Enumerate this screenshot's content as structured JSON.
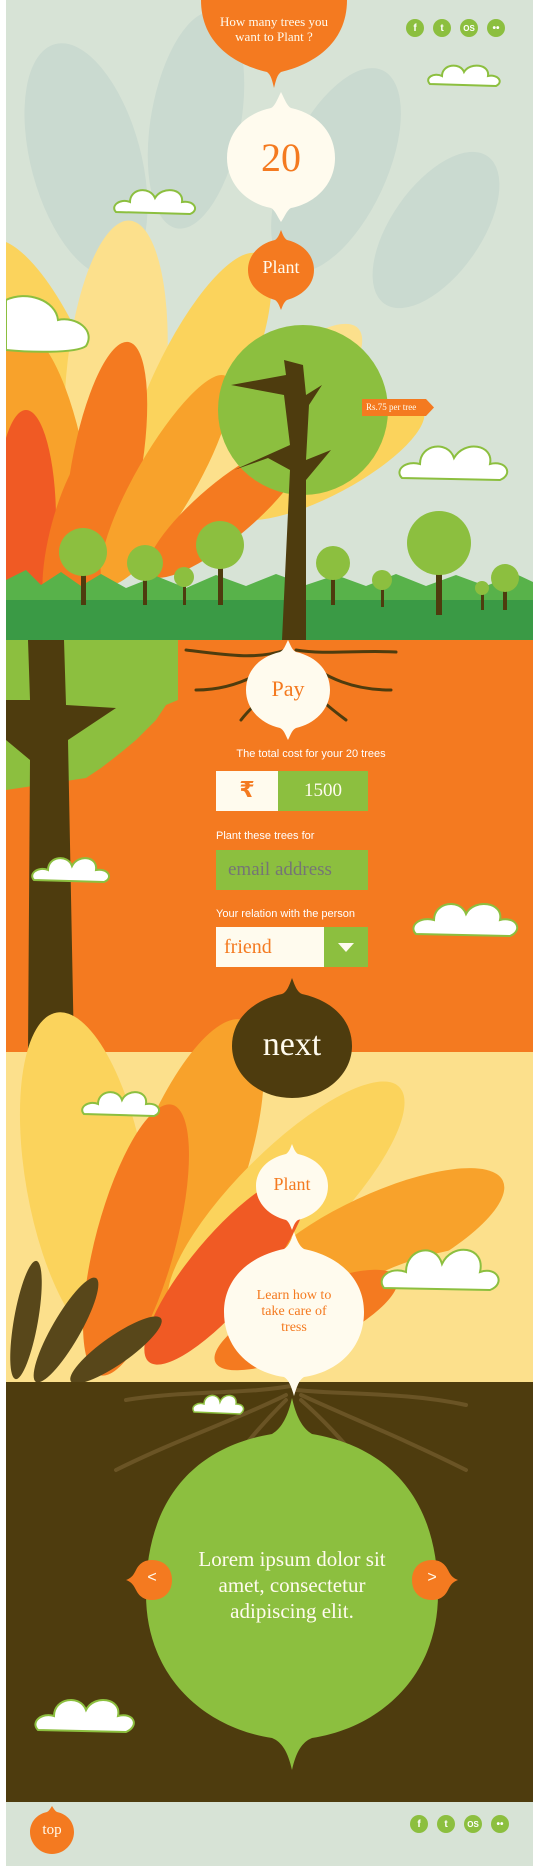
{
  "header": {
    "question": "How many trees you want to Plant ?"
  },
  "social_top": [
    {
      "icon": "facebook-icon",
      "glyph": "f"
    },
    {
      "icon": "twitter-icon",
      "glyph": "t"
    },
    {
      "icon": "os-icon",
      "glyph": "OS"
    },
    {
      "icon": "flickr-icon",
      "glyph": "••"
    }
  ],
  "tree_count": "20",
  "plant_label": "Plant",
  "price_tag": "Rs.75 per tree",
  "pay": {
    "button_label": "Pay",
    "total_label": "The total cost for your 20 trees",
    "currency_symbol": "₹",
    "total_value": "1500",
    "plant_for_label": "Plant these trees for",
    "email_placeholder": "email address",
    "relation_label": "Your relation with the person",
    "relation_value": "friend",
    "next_label": "next"
  },
  "learn": {
    "plant_label": "Plant",
    "learn_text": "Learn how to take care of tress",
    "carousel_text": "Lorem ipsum dolor sit amet, consectetur adipiscing elit.",
    "prev_label": "<",
    "next_label": ">"
  },
  "footer": {
    "top_label": "top"
  },
  "colors": {
    "orange": "#f47a20",
    "green": "#8cbf3f",
    "brown": "#4e3c0e",
    "cream": "#fffbee",
    "sky": "#d7e3d6"
  }
}
